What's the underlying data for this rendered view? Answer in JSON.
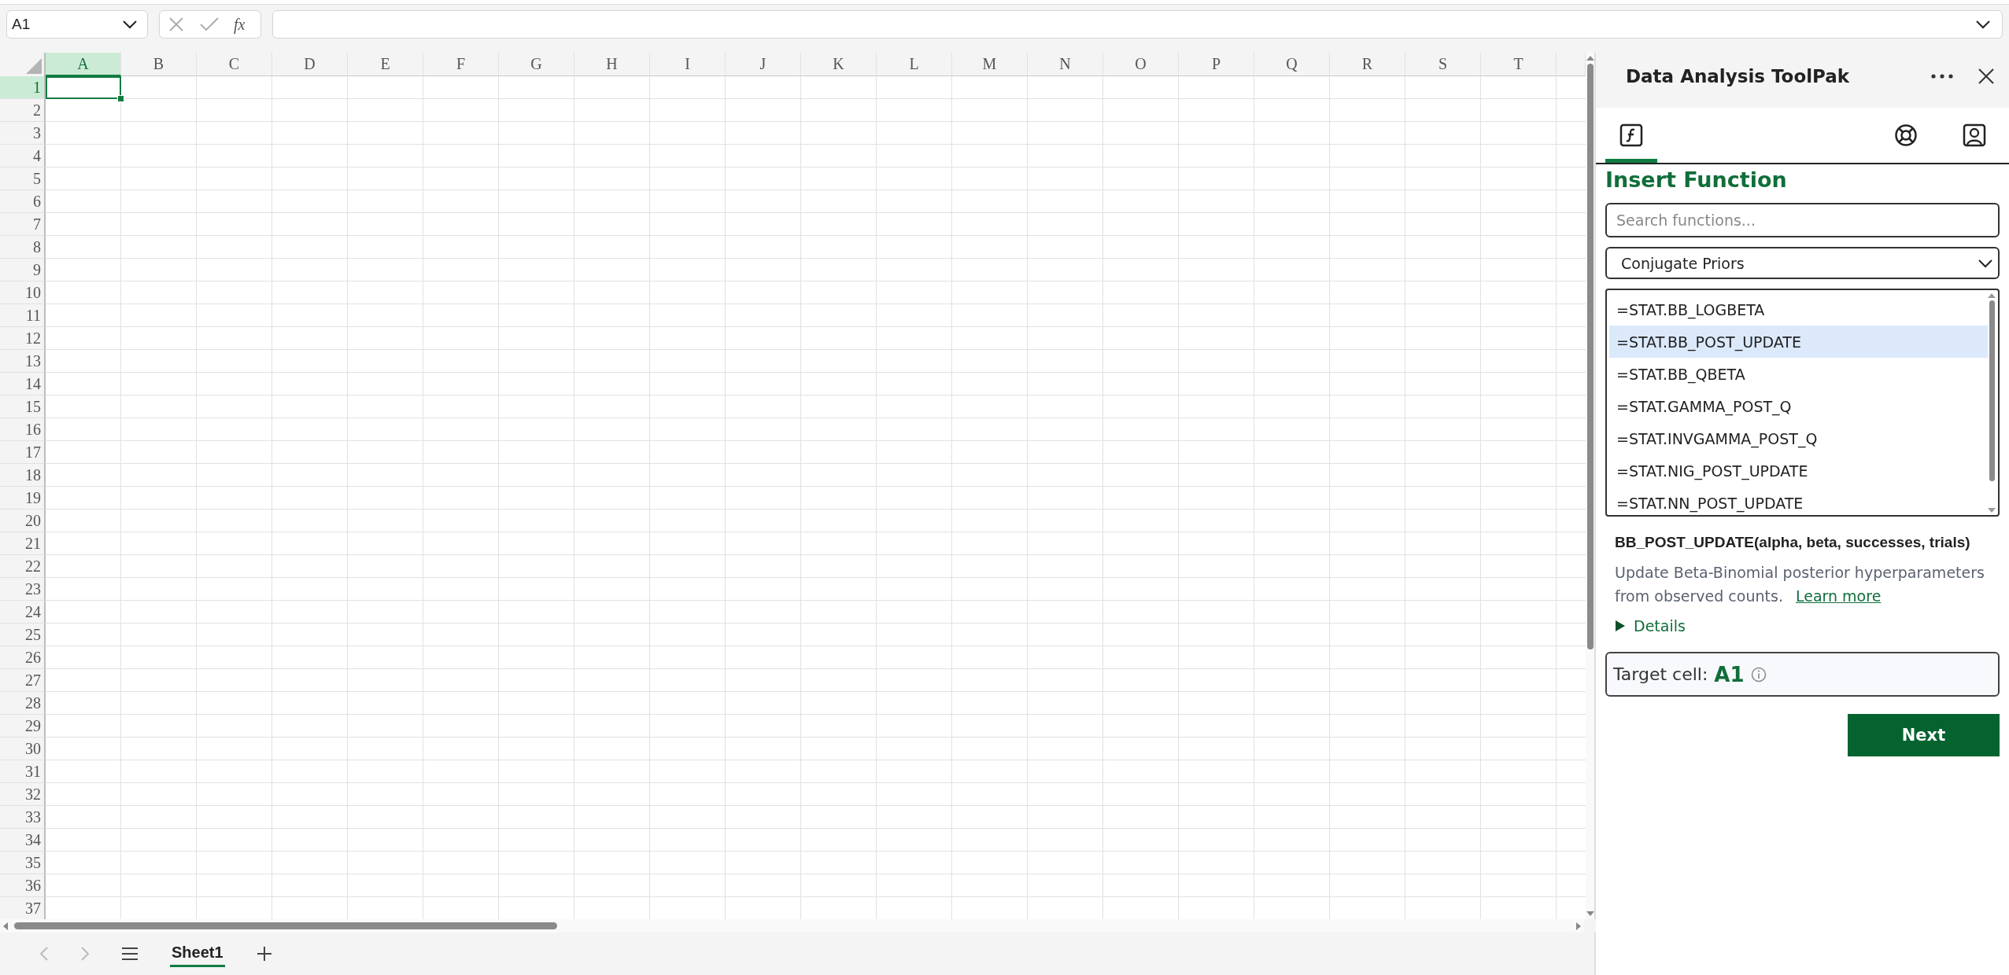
{
  "name_box": {
    "value": "A1"
  },
  "formula_bar": {
    "fx_label": "fx"
  },
  "grid": {
    "columns": [
      {
        "label": "A",
        "selected": true
      },
      {
        "label": "B",
        "selected": false
      },
      {
        "label": "C",
        "selected": false
      },
      {
        "label": "D",
        "selected": false
      },
      {
        "label": "E",
        "selected": false
      },
      {
        "label": "F",
        "selected": false
      },
      {
        "label": "G",
        "selected": false
      },
      {
        "label": "H",
        "selected": false
      },
      {
        "label": "I",
        "selected": false
      },
      {
        "label": "J",
        "selected": false
      },
      {
        "label": "K",
        "selected": false
      },
      {
        "label": "L",
        "selected": false
      },
      {
        "label": "M",
        "selected": false
      },
      {
        "label": "N",
        "selected": false
      },
      {
        "label": "O",
        "selected": false
      },
      {
        "label": "P",
        "selected": false
      },
      {
        "label": "Q",
        "selected": false
      },
      {
        "label": "R",
        "selected": false
      },
      {
        "label": "S",
        "selected": false
      },
      {
        "label": "T",
        "selected": false
      }
    ],
    "rows": [
      {
        "label": "1",
        "selected": true
      },
      {
        "label": "2",
        "selected": false
      },
      {
        "label": "3",
        "selected": false
      },
      {
        "label": "4",
        "selected": false
      },
      {
        "label": "5",
        "selected": false
      },
      {
        "label": "6",
        "selected": false
      },
      {
        "label": "7",
        "selected": false
      },
      {
        "label": "8",
        "selected": false
      },
      {
        "label": "9",
        "selected": false
      },
      {
        "label": "10",
        "selected": false
      },
      {
        "label": "11",
        "selected": false
      },
      {
        "label": "12",
        "selected": false
      },
      {
        "label": "13",
        "selected": false
      },
      {
        "label": "14",
        "selected": false
      },
      {
        "label": "15",
        "selected": false
      },
      {
        "label": "16",
        "selected": false
      },
      {
        "label": "17",
        "selected": false
      },
      {
        "label": "18",
        "selected": false
      },
      {
        "label": "19",
        "selected": false
      },
      {
        "label": "20",
        "selected": false
      },
      {
        "label": "21",
        "selected": false
      },
      {
        "label": "22",
        "selected": false
      },
      {
        "label": "23",
        "selected": false
      },
      {
        "label": "24",
        "selected": false
      },
      {
        "label": "25",
        "selected": false
      },
      {
        "label": "26",
        "selected": false
      },
      {
        "label": "27",
        "selected": false
      },
      {
        "label": "28",
        "selected": false
      },
      {
        "label": "29",
        "selected": false
      },
      {
        "label": "30",
        "selected": false
      },
      {
        "label": "31",
        "selected": false
      },
      {
        "label": "32",
        "selected": false
      },
      {
        "label": "33",
        "selected": false
      },
      {
        "label": "34",
        "selected": false
      },
      {
        "label": "35",
        "selected": false
      },
      {
        "label": "36",
        "selected": false
      },
      {
        "label": "37",
        "selected": false
      }
    ]
  },
  "sheet_tabs": [
    {
      "label": "Sheet1",
      "selected": true
    }
  ],
  "panel": {
    "title": "Data Analysis ToolPak",
    "tabs": [
      {
        "kind": "function",
        "selected": true
      },
      {
        "kind": "help",
        "selected": false
      },
      {
        "kind": "account",
        "selected": false
      }
    ],
    "heading": "Insert Function",
    "search": {
      "placeholder": "Search functions..."
    },
    "category": {
      "value": "Conjugate Priors"
    },
    "functions": [
      {
        "label": "=STAT.BB_LOGBETA",
        "selected": false
      },
      {
        "label": "=STAT.BB_POST_UPDATE",
        "selected": true
      },
      {
        "label": "=STAT.BB_QBETA",
        "selected": false
      },
      {
        "label": "=STAT.GAMMA_POST_Q",
        "selected": false
      },
      {
        "label": "=STAT.INVGAMMA_POST_Q",
        "selected": false
      },
      {
        "label": "=STAT.NIG_POST_UPDATE",
        "selected": false
      },
      {
        "label": "=STAT.NN_POST_UPDATE",
        "selected": false
      }
    ],
    "signature": "BB_POST_UPDATE(alpha, beta, successes, trials)",
    "description": "Update Beta-Binomial posterior hyperparameters from observed counts.",
    "learn_more": "Learn more",
    "details": {
      "label": "Details",
      "expanded": false
    },
    "target_cell": {
      "label": "Target cell:",
      "value": "A1"
    },
    "next_button": "Next"
  }
}
